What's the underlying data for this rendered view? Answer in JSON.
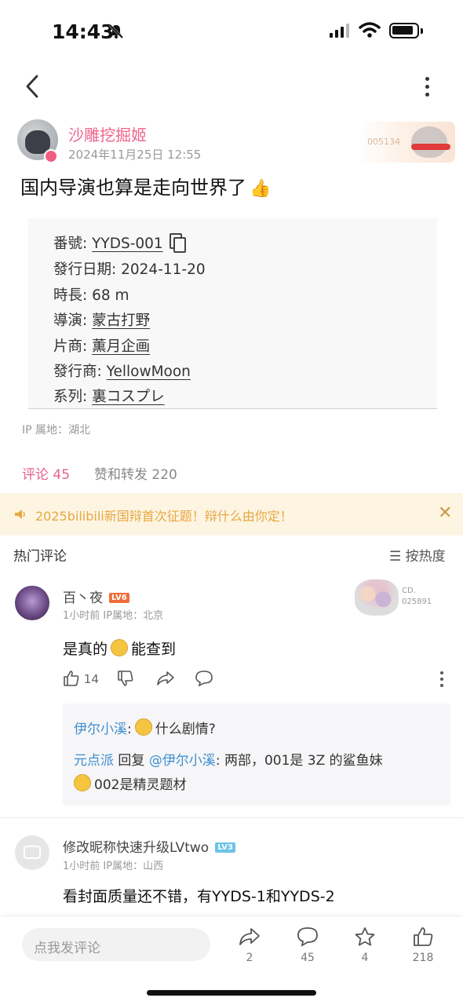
{
  "status_bar": {
    "time": "14:43"
  },
  "author": {
    "name": "沙雕挖掘姬",
    "date": "2024年11月25日 12:55",
    "fan_badge_number": "005134"
  },
  "post": {
    "text": "国内导演也算是走向世界了",
    "emoji": "👍",
    "info": [
      {
        "label": "番號: ",
        "value": "YYDS-001",
        "link": true,
        "copyable": true
      },
      {
        "label": "發行日期: ",
        "value": "2024-11-20",
        "link": false
      },
      {
        "label": "時長: ",
        "value": "68 m",
        "link": false
      },
      {
        "label": "導演: ",
        "value": "蒙古打野",
        "link": true
      },
      {
        "label": "片商: ",
        "value": "薫月企画",
        "link": true
      },
      {
        "label": "發行商: ",
        "value": "YellowMoon",
        "link": true
      },
      {
        "label": "系列: ",
        "value": "裏コスプレ",
        "link": true
      }
    ],
    "ip_location": "IP 属地：湖北"
  },
  "tabs": {
    "comments": "评论 45",
    "likes_reposts": "赞和转发 220"
  },
  "notice": {
    "text": "2025bilibili新国辩首次征题！辩什么由你定！"
  },
  "hot_comments": {
    "title": "热门评论",
    "sort": "按热度"
  },
  "comments": [
    {
      "user": "百丶夜",
      "level": "LV6",
      "meta": "1小时前  IP属地：北京",
      "text_before": "是真的",
      "text_after": "能查到",
      "likes": "14",
      "badge_number": "025891",
      "badge_prefix": "CD.",
      "replies": [
        {
          "user": "伊尔小溪",
          "separator": ":",
          "text": "什么剧情?"
        },
        {
          "user": "元点派",
          "reply_word": " 回复 ",
          "mention": "@伊尔小溪",
          "text": ": 两部，001是 3Z 的鲨鱼妹",
          "text2": "002是精灵题材"
        }
      ]
    },
    {
      "user": "修改昵称快速升级LVtwo",
      "level": "LV3",
      "meta": "1小时前  IP属地：山西",
      "text": "看封面质量还不错，有YYDS-1和YYDS-2"
    }
  ],
  "bottom_bar": {
    "placeholder": "点我发评论",
    "share_count": "2",
    "comment_count": "45",
    "favorite_count": "4",
    "like_count": "218"
  },
  "colors": {
    "accent": "#e6618a",
    "link_blue": "#3f8ed1",
    "notice_bg": "#fdf5e2"
  }
}
